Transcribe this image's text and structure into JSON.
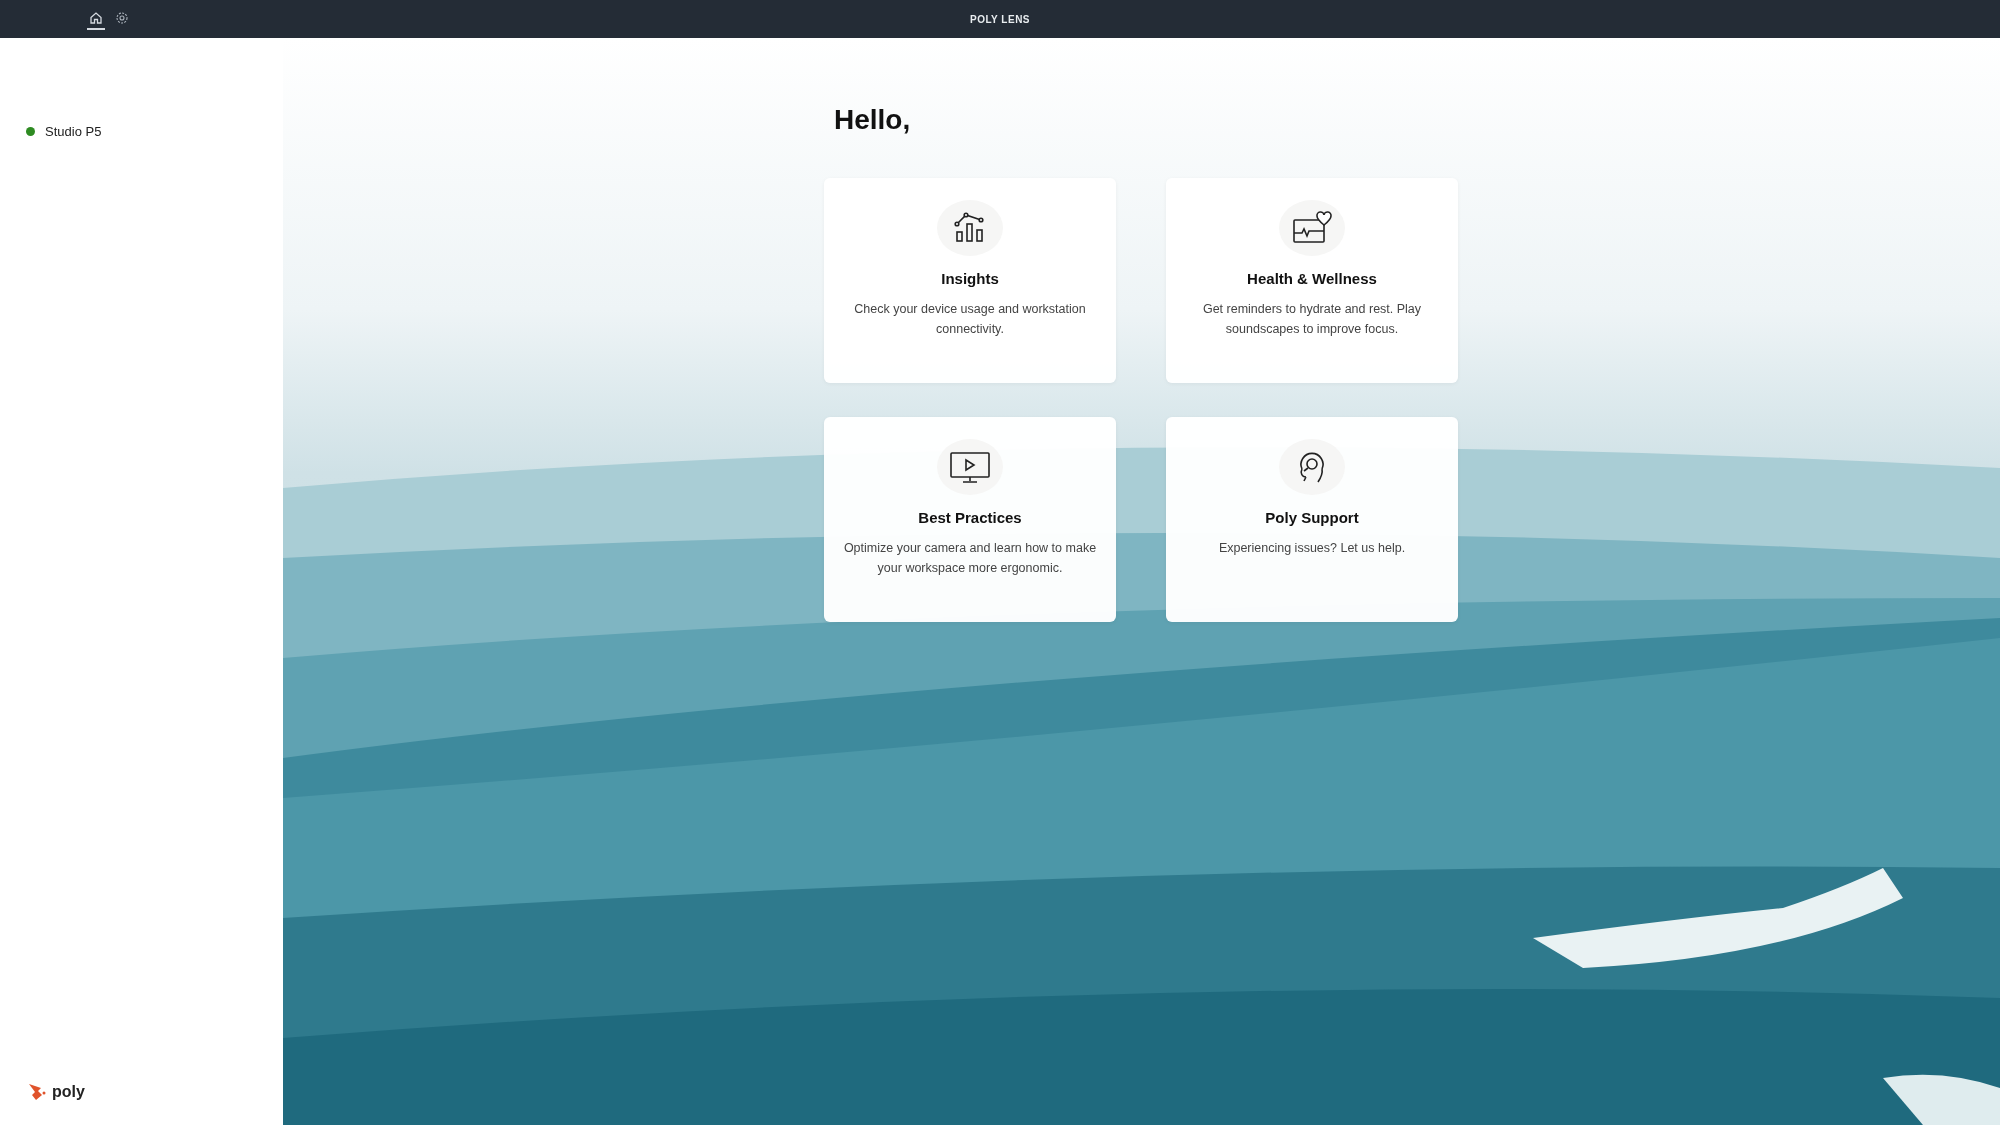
{
  "top_bar": {
    "title": "POLY LENS",
    "nav": [
      {
        "kind": "home",
        "selected": true
      },
      {
        "kind": "settings",
        "selected": false
      }
    ]
  },
  "sidebar": {
    "devices": [
      {
        "name": "Studio P5",
        "color": "#2e8b22"
      }
    ],
    "logo": "poly"
  },
  "greeting": "Hello,",
  "cards": [
    {
      "kind": "insights",
      "title": "Insights",
      "text": "Check your device usage and workstation connectivity."
    },
    {
      "kind": "health",
      "title": "Health & Wellness",
      "text": "Get reminders to hydrate and rest. Play soundscapes to improve focus."
    },
    {
      "kind": "video",
      "title": "Best Practices",
      "text": "Optimize your camera and learn how to make your workspace more ergonomic."
    },
    {
      "kind": "support",
      "title": "Poly Support",
      "text": "Experiencing issues? Let us help."
    }
  ]
}
